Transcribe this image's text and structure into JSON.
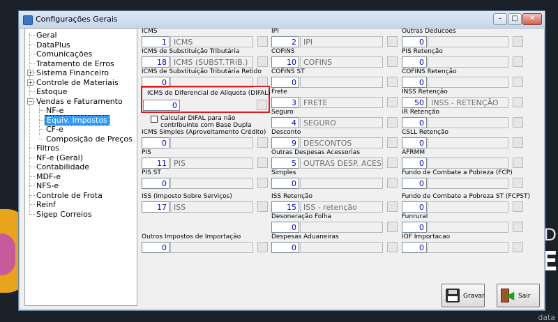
{
  "window": {
    "title": "Configurações Gerais",
    "minimize": "–",
    "maximize": "□",
    "close": "✕"
  },
  "background": {
    "word_large": "E",
    "word_small": "D",
    "footer": "data"
  },
  "tree": {
    "items": [
      {
        "label": "Geral"
      },
      {
        "label": "DataPlus"
      },
      {
        "label": "Comunicações"
      },
      {
        "label": "Tratamento de Erros"
      },
      {
        "label": "Sistema Financeiro",
        "expander": "+"
      },
      {
        "label": "Controle de Materiais",
        "expander": "+"
      },
      {
        "label": "Estoque"
      },
      {
        "label": "Vendas e Faturamento",
        "expander": "−"
      },
      {
        "label": "NF-e"
      },
      {
        "label": "Equiv. Impostos",
        "selected": true
      },
      {
        "label": "CF-e"
      },
      {
        "label": "Composição de Preços"
      },
      {
        "label": "Filtros"
      },
      {
        "label": "NF-e (Geral)"
      },
      {
        "label": "Contabilidade"
      },
      {
        "label": "MDF-e"
      },
      {
        "label": "NFS-e"
      },
      {
        "label": "Controle de Frota"
      },
      {
        "label": "Reinf"
      },
      {
        "label": "Sigep Correios"
      }
    ]
  },
  "col1": [
    {
      "label": "ICMS",
      "code": "1",
      "desc": "ICMS"
    },
    {
      "label": "ICMS de Substituição Tributária",
      "code": "18",
      "desc": "ICMS (SUBST.TRIB.)"
    },
    {
      "label": "ICMS de Substituição Tributária Retido",
      "code": "0",
      "desc": ""
    },
    {
      "label": "ICMS de Diferencial de Alíquota (DIFAL)",
      "code": "0",
      "desc": ""
    },
    {
      "label": "ICMS Simples (Aproveitamento Crédito)",
      "code": "0",
      "desc": ""
    },
    {
      "label": "PIS",
      "code": "11",
      "desc": "PIS"
    },
    {
      "label": "PIS ST",
      "code": "0",
      "desc": ""
    },
    {
      "label": "ISS (Imposto Sobre Serviços)",
      "code": "17",
      "desc": "ISS"
    },
    {
      "label": "Outros Impostos de Importação",
      "code": "0",
      "desc": ""
    }
  ],
  "difal_checkbox": {
    "label_line1": "Calcular DIFAL para não",
    "label_line2": "contribuinte com Base Dupla"
  },
  "col2": [
    {
      "label": "IPI",
      "code": "2",
      "desc": "IPI"
    },
    {
      "label": "COFINS",
      "code": "10",
      "desc": "COFINS"
    },
    {
      "label": "COFINS ST",
      "code": "0",
      "desc": ""
    },
    {
      "label": "Frete",
      "code": "3",
      "desc": "FRETE"
    },
    {
      "label": "Seguro",
      "code": "4",
      "desc": "SEGURO"
    },
    {
      "label": "Desconto",
      "code": "9",
      "desc": "DESCONTOS"
    },
    {
      "label": "Outras Despesas Acessorias",
      "code": "5",
      "desc": "OUTRAS DESP. ACESSO"
    },
    {
      "label": "Simples",
      "code": "0",
      "desc": ""
    },
    {
      "label": "ISS Retenção",
      "code": "15",
      "desc": "ISS - retenção"
    },
    {
      "label": "Desoneração Folha",
      "code": "0",
      "desc": ""
    },
    {
      "label": "Despesas Aduaneiras",
      "code": "0",
      "desc": ""
    }
  ],
  "col3": [
    {
      "label": "Outras Deducoes",
      "code": "0",
      "desc": ""
    },
    {
      "label": "PIS Retenção",
      "code": "0",
      "desc": ""
    },
    {
      "label": "COFINS Retenção",
      "code": "0",
      "desc": ""
    },
    {
      "label": "INSS Retenção",
      "code": "50",
      "desc": "INSS - RETENÇÃO"
    },
    {
      "label": "IR Retenção",
      "code": "0",
      "desc": ""
    },
    {
      "label": "CSLL Retenção",
      "code": "0",
      "desc": ""
    },
    {
      "label": "AFRMM",
      "code": "0",
      "desc": ""
    },
    {
      "label": "Fundo de Combate a Pobreza (FCP)",
      "code": "0",
      "desc": ""
    },
    {
      "label": "Fundo de Combate a Pobreza ST (FCPST)",
      "code": "0",
      "desc": ""
    },
    {
      "label": "Funrural",
      "code": "0",
      "desc": ""
    },
    {
      "label": "IOF Importacao",
      "code": "0",
      "desc": ""
    }
  ],
  "buttons": {
    "save": "Gravar",
    "exit": "Sair"
  }
}
